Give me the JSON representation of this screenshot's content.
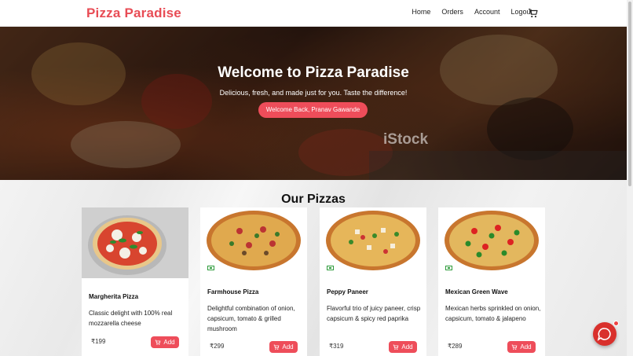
{
  "header": {
    "brand": "Pizza Paradise",
    "nav": [
      "Home",
      "Orders",
      "Account",
      "Logout"
    ],
    "cart_icon": "cart-icon"
  },
  "hero": {
    "title": "Welcome to Pizza Paradise",
    "subtitle": "Delicious, fresh, and made just for you. Taste the difference!",
    "button": "Welcome Back, Pranav Gawande",
    "watermark": "iStock"
  },
  "section": {
    "title": "Our Pizzas"
  },
  "pizzas": [
    {
      "name": "Margherita Pizza",
      "desc": "Classic delight with 100% real mozzarella cheese",
      "price": "₹199",
      "add": "Add"
    },
    {
      "name": "Farmhouse Pizza",
      "desc": "Delightful combination of onion, capsicum, tomato & grilled mushroom",
      "price": "₹299",
      "add": "Add"
    },
    {
      "name": "Peppy Paneer",
      "desc": "Flavorful trio of juicy paneer, crisp capsicum & spicy red paprika",
      "price": "₹319",
      "add": "Add"
    },
    {
      "name": "Mexican Green Wave",
      "desc": "Mexican herbs sprinkled on onion, capsicum, tomato & jalapeno",
      "price": "₹289",
      "add": "Add"
    }
  ],
  "colors": {
    "brand": "#e84c55",
    "button": "#ee4d5a",
    "veg": "#2e9b3b",
    "chat": "#d9302c"
  }
}
